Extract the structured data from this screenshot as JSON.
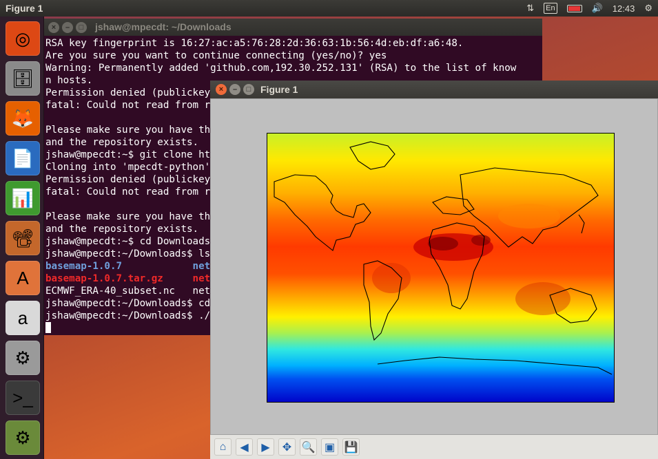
{
  "top_panel": {
    "title": "Figure 1",
    "keyboard_layout": "En",
    "clock": "12:43"
  },
  "launcher": {
    "items": [
      {
        "name": "ubuntu-dash",
        "glyph": "◎",
        "color": "#dd4814"
      },
      {
        "name": "files",
        "glyph": "🗄",
        "color": "#8a8a8a"
      },
      {
        "name": "firefox",
        "glyph": "🦊",
        "color": "#e66000"
      },
      {
        "name": "libreoffice-writer",
        "glyph": "📄",
        "color": "#2a6bbf"
      },
      {
        "name": "libreoffice-calc",
        "glyph": "📊",
        "color": "#3f9a2f"
      },
      {
        "name": "libreoffice-impress",
        "glyph": "📽",
        "color": "#c4672b"
      },
      {
        "name": "software-center",
        "glyph": "A",
        "color": "#e0733a"
      },
      {
        "name": "amazon",
        "glyph": "a",
        "color": "#d9d9d9"
      },
      {
        "name": "system-settings",
        "glyph": "⚙",
        "color": "#9a9a9a"
      },
      {
        "name": "terminal",
        "glyph": ">_",
        "color": "#3a3a3a"
      },
      {
        "name": "python-figure",
        "glyph": "⚙",
        "color": "#6a8a3a"
      }
    ]
  },
  "terminal": {
    "title": "jshaw@mpecdt: ~/Downloads",
    "lines": [
      "RSA key fingerprint is 16:27:ac:a5:76:28:2d:36:63:1b:56:4d:eb:df:a6:48.",
      "Are you sure you want to continue connecting (yes/no)? yes",
      "Warning: Permanently added 'github.com,192.30.252.131' (RSA) to the list of know",
      "n hosts.",
      "Permission denied (publickey).",
      "fatal: Could not read from remote repository.",
      "",
      "Please make sure you have the correct access rights",
      "and the repository exists.",
      "jshaw@mpecdt:~$ git clone https://github.com/mpecdt/mpecdt-python.git",
      "Cloning into 'mpecdt-python'...",
      "Permission denied (publickey).",
      "fatal: Could not read from remote repository.",
      "",
      "Please make sure you have the correct access rights",
      "and the repository exists.",
      "jshaw@mpecdt:~$ cd Downloads",
      "jshaw@mpecdt:~/Downloads$ ls"
    ],
    "listing": [
      {
        "left": "basemap-1.0.7",
        "left_style": "blue",
        "right": "netcdf",
        "right_style": "blue"
      },
      {
        "left": "basemap-1.0.7.tar.gz",
        "left_style": "red",
        "right": "netcdf.tar.gz",
        "right_style": "red"
      },
      {
        "left": "ECMWF_ERA-40_subset.nc",
        "left_style": "",
        "right": "netcdf_plot.py",
        "right_style": ""
      }
    ],
    "after_lines": [
      "jshaw@mpecdt:~/Downloads$ cd",
      "jshaw@mpecdt:~/Downloads$ ./netcdf_plot.py"
    ]
  },
  "figure": {
    "title": "Figure 1",
    "toolbar": [
      {
        "name": "home-icon",
        "glyph": "⌂"
      },
      {
        "name": "back-icon",
        "glyph": "◀"
      },
      {
        "name": "forward-icon",
        "glyph": "▶"
      },
      {
        "name": "pan-icon",
        "glyph": "✥"
      },
      {
        "name": "zoom-icon",
        "glyph": "🔍"
      },
      {
        "name": "subplots-icon",
        "glyph": "▣"
      },
      {
        "name": "save-icon",
        "glyph": "💾"
      }
    ]
  }
}
